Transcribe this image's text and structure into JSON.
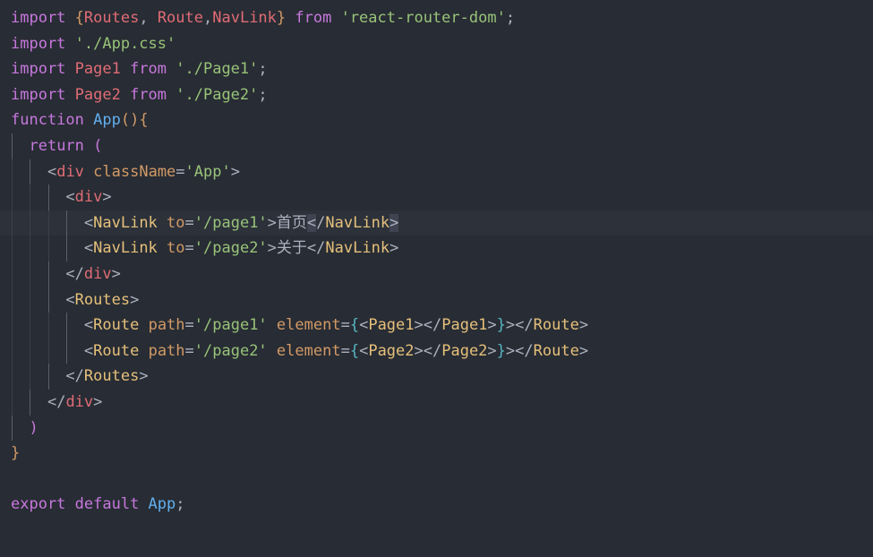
{
  "colors": {
    "background": "#282c34",
    "keyword": "#c678dd",
    "variable": "#e06c75",
    "string": "#98c379",
    "function": "#61afef",
    "tag": "#e5c07b",
    "attribute": "#d19a66",
    "punctuation": "#abb2bf"
  },
  "lines": [
    {
      "tokens": [
        {
          "t": "import ",
          "c": "kw"
        },
        {
          "t": "{",
          "c": "br1"
        },
        {
          "t": "Routes",
          "c": "var"
        },
        {
          "t": ", ",
          "c": "pun"
        },
        {
          "t": "Route",
          "c": "var"
        },
        {
          "t": ",",
          "c": "pun"
        },
        {
          "t": "NavLink",
          "c": "var"
        },
        {
          "t": "}",
          "c": "br1"
        },
        {
          "t": " from ",
          "c": "kw"
        },
        {
          "t": "'react-router-dom'",
          "c": "str"
        },
        {
          "t": ";",
          "c": "pun"
        }
      ]
    },
    {
      "tokens": [
        {
          "t": "import ",
          "c": "kw"
        },
        {
          "t": "'./App.css'",
          "c": "str"
        }
      ]
    },
    {
      "tokens": [
        {
          "t": "import ",
          "c": "kw"
        },
        {
          "t": "Page1",
          "c": "var"
        },
        {
          "t": " from ",
          "c": "kw"
        },
        {
          "t": "'./Page1'",
          "c": "str"
        },
        {
          "t": ";",
          "c": "pun"
        }
      ]
    },
    {
      "tokens": [
        {
          "t": "import ",
          "c": "kw"
        },
        {
          "t": "Page2",
          "c": "var"
        },
        {
          "t": " from ",
          "c": "kw"
        },
        {
          "t": "'./Page2'",
          "c": "str"
        },
        {
          "t": ";",
          "c": "pun"
        }
      ]
    },
    {
      "tokens": [
        {
          "t": "function ",
          "c": "kw"
        },
        {
          "t": "App",
          "c": "fn"
        },
        {
          "t": "()",
          "c": "br1"
        },
        {
          "t": "{",
          "c": "br1"
        }
      ]
    },
    {
      "tokens": [
        {
          "t": "  "
        },
        {
          "t": "return ",
          "c": "kw"
        },
        {
          "t": "(",
          "c": "br2"
        }
      ]
    },
    {
      "tokens": [
        {
          "t": "    "
        },
        {
          "t": "<",
          "c": "pun"
        },
        {
          "t": "div",
          "c": "var"
        },
        {
          "t": " "
        },
        {
          "t": "className",
          "c": "attr"
        },
        {
          "t": "=",
          "c": "pun"
        },
        {
          "t": "'App'",
          "c": "str"
        },
        {
          "t": ">",
          "c": "pun"
        }
      ]
    },
    {
      "tokens": [
        {
          "t": "      "
        },
        {
          "t": "<",
          "c": "pun"
        },
        {
          "t": "div",
          "c": "var"
        },
        {
          "t": ">",
          "c": "pun"
        }
      ]
    },
    {
      "highlight": true,
      "tokens": [
        {
          "t": "        "
        },
        {
          "t": "<",
          "c": "pun"
        },
        {
          "t": "NavLink",
          "c": "tag"
        },
        {
          "t": " "
        },
        {
          "t": "to",
          "c": "attr"
        },
        {
          "t": "=",
          "c": "pun"
        },
        {
          "t": "'/page1'",
          "c": "str"
        },
        {
          "t": ">",
          "c": "pun"
        },
        {
          "t": "首页",
          "c": "txt"
        },
        {
          "t": "<",
          "c": "pun",
          "box": true
        },
        {
          "t": "/",
          "c": "pun"
        },
        {
          "t": "NavLink",
          "c": "tag"
        },
        {
          "t": ">",
          "c": "pun",
          "box": true
        }
      ]
    },
    {
      "tokens": [
        {
          "t": "        "
        },
        {
          "t": "<",
          "c": "pun"
        },
        {
          "t": "NavLink",
          "c": "tag"
        },
        {
          "t": " "
        },
        {
          "t": "to",
          "c": "attr"
        },
        {
          "t": "=",
          "c": "pun"
        },
        {
          "t": "'/page2'",
          "c": "str"
        },
        {
          "t": ">",
          "c": "pun"
        },
        {
          "t": "关于",
          "c": "txt"
        },
        {
          "t": "</",
          "c": "pun"
        },
        {
          "t": "NavLink",
          "c": "tag"
        },
        {
          "t": ">",
          "c": "pun"
        }
      ]
    },
    {
      "tokens": [
        {
          "t": "      "
        },
        {
          "t": "</",
          "c": "pun"
        },
        {
          "t": "div",
          "c": "var"
        },
        {
          "t": ">",
          "c": "pun"
        }
      ]
    },
    {
      "tokens": [
        {
          "t": "      "
        },
        {
          "t": "<",
          "c": "pun"
        },
        {
          "t": "Routes",
          "c": "tag"
        },
        {
          "t": ">",
          "c": "pun"
        }
      ]
    },
    {
      "tokens": [
        {
          "t": "        "
        },
        {
          "t": "<",
          "c": "pun"
        },
        {
          "t": "Route",
          "c": "tag"
        },
        {
          "t": " "
        },
        {
          "t": "path",
          "c": "attr"
        },
        {
          "t": "=",
          "c": "pun"
        },
        {
          "t": "'/page1'",
          "c": "str"
        },
        {
          "t": " "
        },
        {
          "t": "element",
          "c": "attr"
        },
        {
          "t": "=",
          "c": "pun"
        },
        {
          "t": "{",
          "c": "br3"
        },
        {
          "t": "<",
          "c": "pun"
        },
        {
          "t": "Page1",
          "c": "tag"
        },
        {
          "t": "></",
          "c": "pun"
        },
        {
          "t": "Page1",
          "c": "tag"
        },
        {
          "t": ">",
          "c": "pun"
        },
        {
          "t": "}",
          "c": "br3"
        },
        {
          "t": "></",
          "c": "pun"
        },
        {
          "t": "Route",
          "c": "tag"
        },
        {
          "t": ">",
          "c": "pun"
        }
      ]
    },
    {
      "tokens": [
        {
          "t": "        "
        },
        {
          "t": "<",
          "c": "pun"
        },
        {
          "t": "Route",
          "c": "tag"
        },
        {
          "t": " "
        },
        {
          "t": "path",
          "c": "attr"
        },
        {
          "t": "=",
          "c": "pun"
        },
        {
          "t": "'/page2'",
          "c": "str"
        },
        {
          "t": " "
        },
        {
          "t": "element",
          "c": "attr"
        },
        {
          "t": "=",
          "c": "pun"
        },
        {
          "t": "{",
          "c": "br3"
        },
        {
          "t": "<",
          "c": "pun"
        },
        {
          "t": "Page2",
          "c": "tag"
        },
        {
          "t": "></",
          "c": "pun"
        },
        {
          "t": "Page2",
          "c": "tag"
        },
        {
          "t": ">",
          "c": "pun"
        },
        {
          "t": "}",
          "c": "br3"
        },
        {
          "t": "></",
          "c": "pun"
        },
        {
          "t": "Route",
          "c": "tag"
        },
        {
          "t": ">",
          "c": "pun"
        }
      ]
    },
    {
      "tokens": [
        {
          "t": "      "
        },
        {
          "t": "</",
          "c": "pun"
        },
        {
          "t": "Routes",
          "c": "tag"
        },
        {
          "t": ">",
          "c": "pun"
        }
      ]
    },
    {
      "tokens": [
        {
          "t": "    "
        },
        {
          "t": "</",
          "c": "pun"
        },
        {
          "t": "div",
          "c": "var"
        },
        {
          "t": ">",
          "c": "pun"
        }
      ]
    },
    {
      "tokens": [
        {
          "t": "  "
        },
        {
          "t": ")",
          "c": "br2"
        }
      ]
    },
    {
      "tokens": [
        {
          "t": "}",
          "c": "br1"
        }
      ]
    },
    {
      "tokens": []
    },
    {
      "tokens": [
        {
          "t": "export ",
          "c": "kw"
        },
        {
          "t": "default ",
          "c": "kw"
        },
        {
          "t": "App",
          "c": "fn"
        },
        {
          "t": ";",
          "c": "pun"
        }
      ]
    }
  ]
}
